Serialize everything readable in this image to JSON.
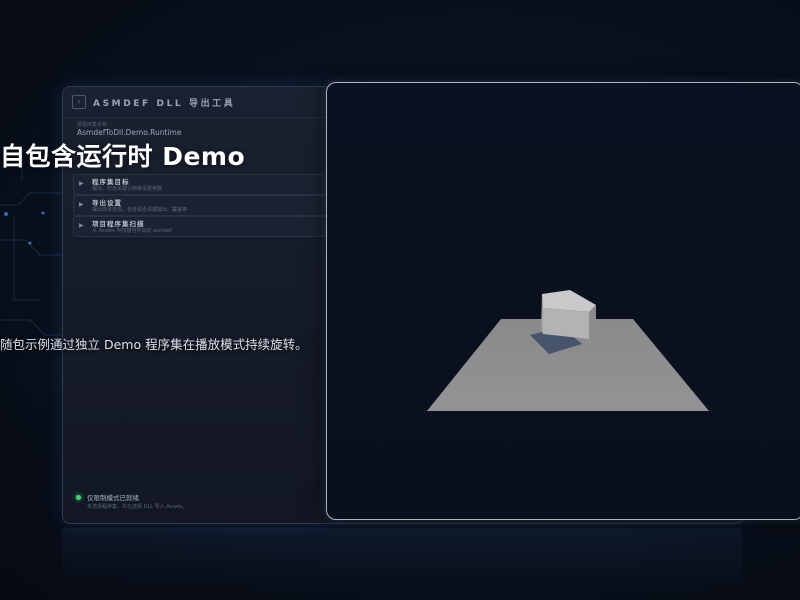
{
  "hero": {
    "title": "自包含运行时 Demo",
    "subtitle": "随包示例通过独立 Demo 程序集在播放模式持续旋转。"
  },
  "tool_window": {
    "collapse_icon": "chevron-left-icon",
    "title": "ASMDEF DLL 导出工具",
    "assembly_label": "源程序集名称",
    "assembly_value": "AsmdefToDll.Demo.Runtime",
    "sections": [
      {
        "title": "程序集目标",
        "description": "输出、仅含关键引用等设置参数",
        "icon": "chevron-right-icon"
      },
      {
        "title": "导出设置",
        "description": "输出目录选项，包含是否清理输出、覆盖等",
        "icon": "chevron-right-icon"
      },
      {
        "title": "项目程序集扫描",
        "description": "从 Assets 中扫描可导出的 asmdef",
        "icon": "chevron-right-icon"
      }
    ],
    "status": {
      "title": "仅限制模式已就绪",
      "description": "未选择程序集，先在选择 DLL 导入 Assets。",
      "dot_color": "#3fd46c"
    }
  },
  "viewport": {
    "scene": "rotating-cube-on-plane",
    "colors": {
      "plane": "#8f8f91",
      "cube_top": "#c9c9cb",
      "cube_front": "#b3b3b5",
      "cube_side": "#8c8c8e",
      "shadow": "#3a4a66"
    }
  }
}
